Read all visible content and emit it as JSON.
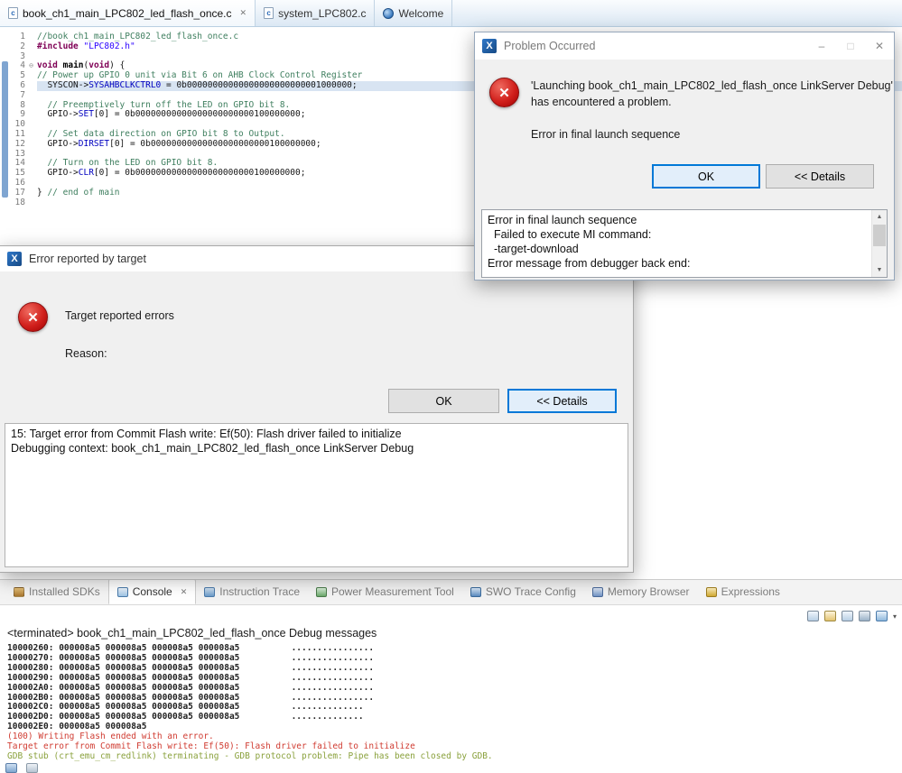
{
  "colors": {
    "accent_blue": "#0078d7",
    "error_red": "#c00000",
    "console_stderr_red": "#d03c32",
    "console_gdb_olive": "#8aa13c",
    "comment_green": "#3f7f5f",
    "keyword_purple": "#7f0055",
    "string_blue": "#2a00ff",
    "field_blue": "#0000c0",
    "line_highlight": "#d8e4f2"
  },
  "icons": {
    "scroll_up": "▲",
    "scroll_down": "▼",
    "menu_arrow": "▾",
    "fold_minus": "⊖",
    "error_cross": "✕",
    "x_logo": "X"
  },
  "editor_tabs": [
    {
      "label": "book_ch1_main_LPC802_led_flash_once.c",
      "icon_letter": "c",
      "close_glyph": "✕"
    },
    {
      "label": "system_LPC802.c",
      "icon_letter": "c"
    },
    {
      "label": "Welcome"
    }
  ],
  "editor": {
    "lines": [
      {
        "n": "1",
        "segs": [
          [
            "cm",
            "//book_ch1_main_LPC802_led_flash_once.c"
          ]
        ]
      },
      {
        "n": "2",
        "segs": [
          [
            "dir",
            "#include"
          ],
          [
            "pl",
            " "
          ],
          [
            "str",
            "\"LPC802.h\""
          ]
        ]
      },
      {
        "n": "3",
        "segs": []
      },
      {
        "n": "4",
        "fold": true,
        "segs": [
          [
            "kw",
            "void"
          ],
          [
            "pl",
            " "
          ],
          [
            "fn",
            "main"
          ],
          [
            "pl",
            "("
          ],
          [
            "kw",
            "void"
          ],
          [
            "pl",
            ") {"
          ]
        ]
      },
      {
        "n": "5",
        "segs": [
          [
            "cm",
            "// Power up GPIO 0 unit via Bit 6 on AHB Clock Control Register"
          ]
        ]
      },
      {
        "n": "6",
        "hl": true,
        "segs": [
          [
            "pl",
            "  SYSCON->"
          ],
          [
            "fld",
            "SYSAHBCLKCTRL0"
          ],
          [
            "pl",
            " = 0b00000000000000000000000001000000;"
          ]
        ]
      },
      {
        "n": "7",
        "segs": []
      },
      {
        "n": "8",
        "segs": [
          [
            "cm",
            "  // Preemptively turn off the LED on GPIO bit 8."
          ]
        ]
      },
      {
        "n": "9",
        "segs": [
          [
            "pl",
            "  GPIO->"
          ],
          [
            "fld",
            "SET"
          ],
          [
            "pl",
            "[0] = 0b00000000000000000000000100000000;"
          ]
        ]
      },
      {
        "n": "10",
        "segs": []
      },
      {
        "n": "11",
        "segs": [
          [
            "cm",
            "  // Set data direction on GPIO bit 8 to Output."
          ]
        ]
      },
      {
        "n": "12",
        "segs": [
          [
            "pl",
            "  GPIO->"
          ],
          [
            "fld",
            "DIRSET"
          ],
          [
            "pl",
            "[0] = 0b00000000000000000000000100000000;"
          ]
        ]
      },
      {
        "n": "13",
        "segs": []
      },
      {
        "n": "14",
        "segs": [
          [
            "cm",
            "  // Turn on the LED on GPIO bit 8."
          ]
        ]
      },
      {
        "n": "15",
        "segs": [
          [
            "pl",
            "  GPIO->"
          ],
          [
            "fld",
            "CLR"
          ],
          [
            "pl",
            "[0] = 0b00000000000000000000000100000000;"
          ]
        ]
      },
      {
        "n": "16",
        "segs": []
      },
      {
        "n": "17",
        "segs": [
          [
            "pl",
            "} "
          ],
          [
            "cm",
            "// end of main"
          ]
        ]
      },
      {
        "n": "18",
        "segs": []
      }
    ]
  },
  "problem_dialog": {
    "title": "Problem Occurred",
    "minimize_glyph": "–",
    "maximize_glyph": "□",
    "close_glyph": "✕",
    "message": "'Launching book_ch1_main_LPC802_led_flash_once LinkServer Debug' has encountered a problem.",
    "submessage": "Error in final launch sequence",
    "ok_label": "OK",
    "details_label": "<< Details",
    "details_lines": [
      "Error in final launch sequence",
      "  Failed to execute MI command:",
      "  -target-download",
      "Error message from debugger back end:"
    ]
  },
  "target_dialog": {
    "title": "Error reported by target",
    "message": "Target reported errors",
    "reason_label": "Reason:",
    "ok_label": "OK",
    "details_label": "<< Details",
    "details_lines": [
      "15: Target error from Commit Flash write: Ef(50): Flash driver failed to initialize",
      "Debugging context: book_ch1_main_LPC802_led_flash_once LinkServer Debug"
    ]
  },
  "bottom_tabs": [
    {
      "label": "Installed SDKs"
    },
    {
      "label": "Console",
      "close_glyph": "✕"
    },
    {
      "label": "Instruction Trace"
    },
    {
      "label": "Power Measurement Tool"
    },
    {
      "label": "SWO Trace Config"
    },
    {
      "label": "Memory Browser"
    },
    {
      "label": "Expressions"
    }
  ],
  "console": {
    "header": "<terminated> book_ch1_main_LPC802_led_flash_once Debug messages",
    "lines": [
      {
        "cls": "dump",
        "text": "10000260: 000008a5 000008a5 000008a5 000008a5          ................"
      },
      {
        "cls": "dump",
        "text": "10000270: 000008a5 000008a5 000008a5 000008a5          ................"
      },
      {
        "cls": "dump",
        "text": "10000280: 000008a5 000008a5 000008a5 000008a5          ................"
      },
      {
        "cls": "dump",
        "text": "10000290: 000008a5 000008a5 000008a5 000008a5          ................"
      },
      {
        "cls": "dump",
        "text": "100002A0: 000008a5 000008a5 000008a5 000008a5          ................"
      },
      {
        "cls": "dump",
        "text": "100002B0: 000008a5 000008a5 000008a5 000008a5          ................"
      },
      {
        "cls": "dump",
        "text": "100002C0: 000008a5 000008a5 000008a5 000008a5          .............."
      },
      {
        "cls": "dump",
        "text": "100002D0: 000008a5 000008a5 000008a5 000008a5          .............."
      },
      {
        "cls": "dump",
        "text": "100002E0: 000008a5 000008a5"
      },
      {
        "cls": "err",
        "text": "(100) Writing Flash ended with an error."
      },
      {
        "cls": "err",
        "text": "Target error from Commit Flash write: Ef(50): Flash driver failed to initialize"
      },
      {
        "cls": "gdb",
        "text": "GDB stub (crt_emu_cm_redlink) terminating - GDB protocol problem: Pipe has been closed by GDB."
      }
    ]
  }
}
